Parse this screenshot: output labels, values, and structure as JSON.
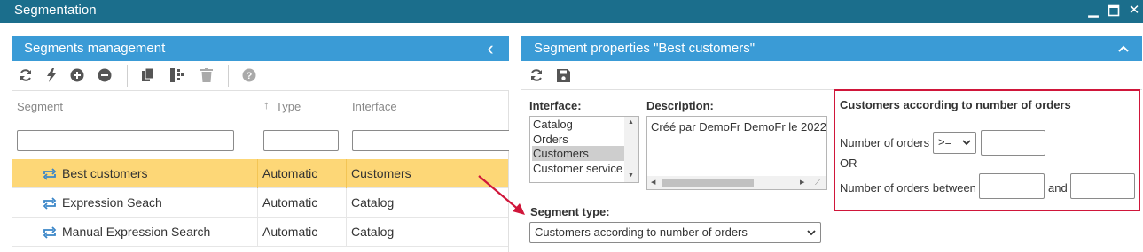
{
  "window": {
    "title": "Segmentation",
    "minimize_glyph": "▁",
    "maximize_glyph": "◻",
    "close_glyph": "✕"
  },
  "left_panel": {
    "title": "Segments management",
    "collapse_glyph": "‹",
    "toolbar_icons": [
      "refresh-icon",
      "lightning-icon",
      "plus-circle-icon",
      "minus-circle-icon",
      "copy-icon",
      "split-icon",
      "trash-icon",
      "help-icon"
    ],
    "columns": {
      "segment": "Segment",
      "type": "Type",
      "type_sort_glyph": "↑",
      "interface": "Interface"
    },
    "rows": [
      {
        "name": "Best customers",
        "type": "Automatic",
        "interface": "Customers",
        "selected": true
      },
      {
        "name": "Expression Seach",
        "type": "Automatic",
        "interface": "Catalog",
        "selected": false
      },
      {
        "name": "Manual Expression Search",
        "type": "Automatic",
        "interface": "Catalog",
        "selected": false
      }
    ],
    "row_icon": "repeat-icon"
  },
  "right_panel": {
    "title": "Segment properties \"Best customers\"",
    "collapse_glyph": "︿",
    "toolbar_icons": [
      "refresh-icon",
      "save-icon"
    ],
    "interface_label": "Interface:",
    "interface_options": [
      "Catalog",
      "Orders",
      "Customers",
      "Customer service"
    ],
    "interface_selected": "Customers",
    "description_label": "Description:",
    "description_value": "Créé par DemoFr DemoFr le 2022",
    "segment_type_label": "Segment type:",
    "segment_type_value": "Customers according to number of orders",
    "criteria": {
      "title": "Customers according to number of orders",
      "number_of_orders_label": "Number of orders",
      "operator_value": ">=",
      "or_label": "OR",
      "between_label": "Number of orders between",
      "and_label": "and"
    }
  },
  "colors": {
    "titlebar": "#1b6e8c",
    "panel_header": "#3a9bd6",
    "selected_row": "#fdd777",
    "highlight_border": "#d0163a",
    "annotation_arrow": "#d0163a"
  }
}
